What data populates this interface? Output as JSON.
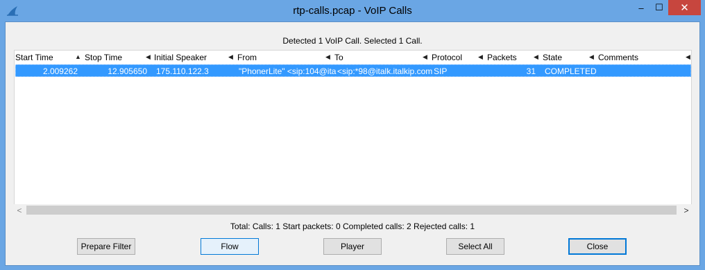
{
  "window": {
    "title": "rtp-calls.pcap - VoIP Calls",
    "controls": {
      "minimize": "–",
      "maximize": "☐",
      "close": "✕"
    }
  },
  "status": {
    "detected": "Detected 1 VoIP Call. Selected 1 Call."
  },
  "table": {
    "columns": [
      {
        "label": "Start Time",
        "sort": "▲"
      },
      {
        "label": "Stop Time",
        "sort": "◀"
      },
      {
        "label": "Initial Speaker",
        "sort": "◀"
      },
      {
        "label": "From",
        "sort": "◀"
      },
      {
        "label": "To",
        "sort": "◀"
      },
      {
        "label": "Protocol",
        "sort": "◀"
      },
      {
        "label": "Packets",
        "sort": "◀"
      },
      {
        "label": "State",
        "sort": "◀"
      },
      {
        "label": "Comments",
        "sort": "◀"
      }
    ],
    "rows": [
      {
        "start_time": "2.009262",
        "stop_time": "12.905650",
        "initial_speaker": "175.110.122.3",
        "from": "\"PhonerLite\" <sip:104@ita",
        "to": "<sip:*98@italk.italkip.com",
        "protocol": "SIP",
        "packets": "31",
        "state": "COMPLETED",
        "comments": ""
      }
    ]
  },
  "scrollbar": {
    "left_arrow": "<",
    "right_arrow": ">"
  },
  "summary": "Total: Calls: 1   Start packets: 0   Completed calls: 2   Rejected calls: 1",
  "buttons": {
    "prepare_filter": "Prepare Filter",
    "flow": "Flow",
    "player": "Player",
    "select_all": "Select All",
    "close": "Close"
  },
  "colors": {
    "title_bar": "#6aa6e4",
    "selection": "#3399ff",
    "close_button": "#c7463e"
  }
}
